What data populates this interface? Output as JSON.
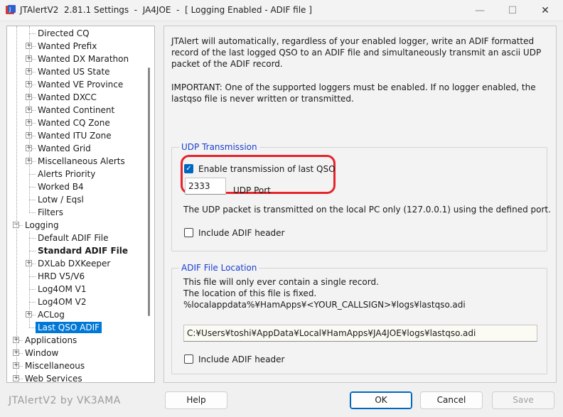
{
  "window": {
    "title": "JTAlertV2  2.81.1 Settings  -  JA4JOE  -  [ Logging Enabled - ADIF file ]",
    "minimize_glyph": "—",
    "maximize_glyph": "☐",
    "close_glyph": "✕"
  },
  "tree": {
    "items": [
      {
        "label": "Directed CQ",
        "indent": 2,
        "expander": "none"
      },
      {
        "label": "Wanted Prefix",
        "indent": 2,
        "expander": "+"
      },
      {
        "label": "Wanted DX Marathon",
        "indent": 2,
        "expander": "+"
      },
      {
        "label": "Wanted US State",
        "indent": 2,
        "expander": "+"
      },
      {
        "label": "Wanted VE Province",
        "indent": 2,
        "expander": "+"
      },
      {
        "label": "Wanted DXCC",
        "indent": 2,
        "expander": "+"
      },
      {
        "label": "Wanted Continent",
        "indent": 2,
        "expander": "+"
      },
      {
        "label": "Wanted CQ Zone",
        "indent": 2,
        "expander": "+"
      },
      {
        "label": "Wanted ITU Zone",
        "indent": 2,
        "expander": "+"
      },
      {
        "label": "Wanted Grid",
        "indent": 2,
        "expander": "+"
      },
      {
        "label": "Miscellaneous Alerts",
        "indent": 2,
        "expander": "+"
      },
      {
        "label": "Alerts Priority",
        "indent": 2,
        "expander": "none"
      },
      {
        "label": "Worked B4",
        "indent": 2,
        "expander": "none"
      },
      {
        "label": "Lotw / Eqsl",
        "indent": 2,
        "expander": "none"
      },
      {
        "label": "Filters",
        "indent": 2,
        "expander": "none"
      },
      {
        "label": "Logging",
        "indent": 1,
        "expander": "-"
      },
      {
        "label": "Default ADIF File",
        "indent": 2,
        "expander": "none"
      },
      {
        "label": "Standard ADIF File",
        "indent": 2,
        "expander": "none",
        "bold": true
      },
      {
        "label": "DXLab DXKeeper",
        "indent": 2,
        "expander": "+"
      },
      {
        "label": "HRD V5/V6",
        "indent": 2,
        "expander": "none"
      },
      {
        "label": "Log4OM V1",
        "indent": 2,
        "expander": "none"
      },
      {
        "label": "Log4OM V2",
        "indent": 2,
        "expander": "none"
      },
      {
        "label": "ACLog",
        "indent": 2,
        "expander": "+"
      },
      {
        "label": "Last QSO ADIF",
        "indent": 2,
        "expander": "none",
        "selected": true
      },
      {
        "label": "Applications",
        "indent": 1,
        "expander": "+"
      },
      {
        "label": "Window",
        "indent": 1,
        "expander": "+"
      },
      {
        "label": "Miscellaneous",
        "indent": 1,
        "expander": "+"
      },
      {
        "label": "Web Services",
        "indent": 1,
        "expander": "+"
      }
    ]
  },
  "content": {
    "intro": "JTAlert will automatically, regardless of your enabled logger, write an ADIF formatted record of the last logged QSO to an ADIF file and simultaneously transmit an ascii UDP packet of the ADIF record.",
    "important": "IMPORTANT: One of the supported loggers must be enabled. If no logger enabled, the lastqso file is never written or transmitted.",
    "udp": {
      "title": "UDP Transmission",
      "enable_label": "Enable transmission of last QSO",
      "enable_checked": true,
      "port_value": "2333",
      "port_label": "UDP Port",
      "description": "The UDP packet is transmitted on the local PC only (127.0.0.1) using the defined port.",
      "include_header_label": "Include ADIF header",
      "include_header_checked": false
    },
    "adif": {
      "title": "ADIF File Location",
      "line1": "This file will only ever contain a single record.",
      "line2": "The location of this file is fixed.",
      "line3": "%localappdata%¥HamApps¥<YOUR_CALLSIGN>¥logs¥lastqso.adi",
      "path_value": "C:¥Users¥toshi¥AppData¥Local¥HamApps¥JA4JOE¥logs¥lastqso.adi",
      "include_header_label": "Include ADIF header",
      "include_header_checked": false
    }
  },
  "footer": {
    "brand": "JTAlertV2 by VK3AMA",
    "help_label": "Help",
    "ok_label": "OK",
    "cancel_label": "Cancel",
    "save_label": "Save"
  },
  "colors": {
    "accent": "#0067c0",
    "group_title": "#1a3fcf",
    "highlight_ring": "#e6242b",
    "selection": "#0078d7"
  }
}
